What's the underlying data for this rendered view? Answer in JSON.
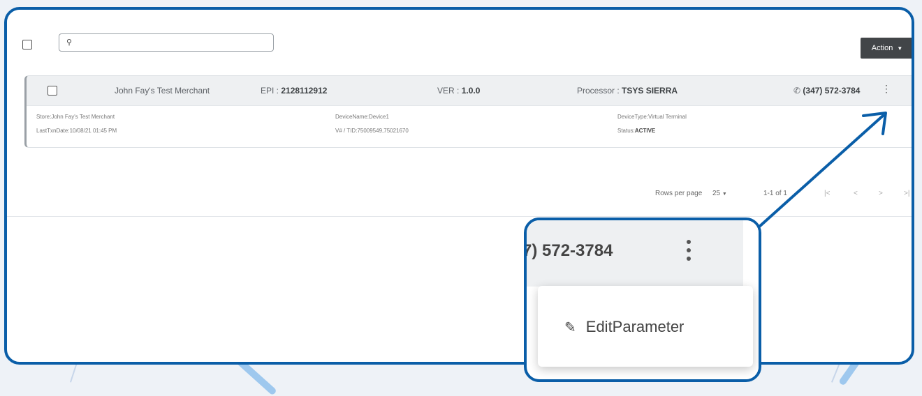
{
  "toolbar": {
    "action_label": "Action",
    "action_icon": "caret-down-icon"
  },
  "search": {
    "placeholder": ""
  },
  "record": {
    "merchant_name": "John Fay's Test Merchant",
    "epi_label": "EPI :",
    "epi_value": "2128112912",
    "ver_label": "VER :",
    "ver_value": "1.0.0",
    "processor_label": "Processor :",
    "processor_value": "TSYS SIERRA",
    "phone": "(347) 572-3784",
    "store_label": "Store:",
    "store_value": "John Fay's Test Merchant",
    "last_txn_label": "LastTxnDate:",
    "last_txn_value": "10/08/21 01:45 PM",
    "device_name_label": "DeviceName:",
    "device_name_value": "Device1",
    "vid_label": "V# / TID:",
    "vid_value": "75009549,75021670",
    "device_type_label": "DeviceType:",
    "device_type_value": "Virtual Terminal",
    "status_label": "Status:",
    "status_value": "ACTIVE"
  },
  "pagination": {
    "rows_per_page_label": "Rows per page",
    "rows_per_page_value": "25",
    "range": "1-1 of 1"
  },
  "zoom": {
    "phone_fragment": "7) 572-3784",
    "menu_item_label": "EditParameter"
  },
  "colors": {
    "frame_border": "#0a5ea8",
    "action_button": "#424548"
  }
}
